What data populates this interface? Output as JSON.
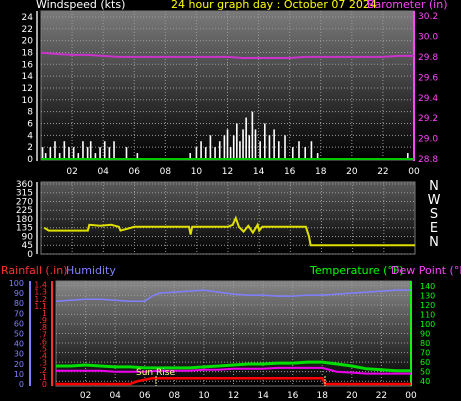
{
  "header": {
    "wind_label": "Windspeed (kts)",
    "date_title": "24 hour graph day : October 07 2024",
    "barometer_label": "Barometer (in)"
  },
  "labels": {
    "compass": [
      "N",
      "W",
      "S",
      "E",
      "N"
    ],
    "rainfall": "Rainfall (.in)",
    "humidity": "Humidity",
    "temperature": "Temperature (°F)",
    "dewpoint": "Dew Point (°F)",
    "sunrise": "Sun Rise"
  },
  "colors": {
    "wind": "#ffffff",
    "barometer": "#ff44ff",
    "direction": "#ffff00",
    "rain": "#ff0000",
    "humidity": "#8080ff",
    "temperature": "#00ff00",
    "dewpoint": "#ff00ff",
    "title": "#ffff00",
    "rain_label": "#ff3030",
    "humidity_label": "#8080ff",
    "temperature_label": "#00ff00",
    "dewpoint_label": "#ff40ff",
    "sunrise_label": "#ffff80"
  },
  "chart_data": [
    {
      "type": "bar",
      "id": "wind",
      "x_ticks": [
        "02",
        "04",
        "06",
        "08",
        "10",
        "12",
        "14",
        "16",
        "18",
        "20",
        "22",
        "00"
      ],
      "y_ticks": [
        0,
        2,
        4,
        6,
        8,
        10,
        12,
        14,
        16,
        18,
        20,
        22,
        24
      ],
      "ylim": [
        0,
        25
      ],
      "title": "Windspeed (kts)",
      "series": [
        {
          "name": "Windspeed (kts)",
          "x_hours": [
            0.1,
            0.3,
            0.6,
            0.9,
            1.2,
            1.5,
            1.8,
            2.1,
            2.4,
            2.7,
            3.0,
            3.2,
            3.5,
            3.8,
            4.1,
            4.4,
            4.7,
            5.5,
            6.2,
            9.6,
            10.0,
            10.3,
            10.6,
            10.9,
            11.2,
            11.5,
            11.8,
            12.0,
            12.2,
            12.4,
            12.6,
            12.8,
            13.0,
            13.2,
            13.4,
            13.6,
            13.8,
            14.1,
            14.4,
            14.7,
            15.0,
            15.3,
            15.7,
            16.2,
            16.6,
            17.0,
            17.4,
            17.8,
            23.6
          ],
          "values": [
            2,
            1,
            2,
            3,
            1,
            3,
            2,
            2,
            1,
            3,
            2,
            3,
            1,
            2,
            3,
            2,
            3,
            2,
            1,
            1,
            2,
            3,
            2,
            4,
            2,
            3,
            4,
            5,
            2,
            4,
            6,
            3,
            5,
            7,
            4,
            8,
            5,
            3,
            6,
            4,
            5,
            3,
            4,
            2,
            3,
            2,
            3,
            1,
            1
          ]
        },
        {
          "name": "Barometer (in)",
          "x_hours": [
            0,
            1,
            2,
            3,
            4,
            5,
            6,
            7,
            8,
            9,
            10,
            11,
            12,
            13,
            14,
            15,
            16,
            17,
            18,
            19,
            20,
            21,
            22,
            23,
            24
          ],
          "values": [
            29.84,
            29.83,
            29.82,
            29.82,
            29.81,
            29.8,
            29.8,
            29.8,
            29.8,
            29.8,
            29.8,
            29.8,
            29.8,
            29.79,
            29.79,
            29.79,
            29.79,
            29.8,
            29.8,
            29.8,
            29.8,
            29.8,
            29.8,
            29.81,
            29.81
          ],
          "ylim": [
            28.8,
            30.25
          ],
          "y_ticks": [
            28.8,
            29.0,
            29.2,
            29.4,
            29.6,
            29.8,
            30.0,
            30.2
          ]
        }
      ]
    },
    {
      "type": "line",
      "id": "direction",
      "y_ticks": [
        0,
        45,
        90,
        135,
        180,
        225,
        270,
        315,
        360
      ],
      "ylim": [
        0,
        370
      ],
      "series": [
        {
          "x_hours": [
            0.2,
            0.5,
            1.0,
            2.0,
            3.0,
            3.1,
            3.8,
            4.5,
            5.0,
            5.1,
            6.0,
            9.0,
            9.5,
            9.6,
            9.7,
            10.0,
            11.0,
            12.0,
            12.3,
            12.5,
            12.7,
            13.0,
            13.3,
            13.6,
            13.9,
            14.0,
            14.2,
            14.5,
            15.0,
            17.0,
            17.2,
            17.3,
            20.0,
            24.0
          ],
          "values": [
            135,
            120,
            120,
            120,
            120,
            150,
            145,
            150,
            140,
            120,
            140,
            140,
            140,
            100,
            140,
            140,
            140,
            140,
            150,
            185,
            140,
            115,
            145,
            110,
            150,
            120,
            140,
            140,
            140,
            140,
            90,
            45,
            45,
            45
          ]
        }
      ]
    },
    {
      "type": "line",
      "id": "temp",
      "x_ticks": [
        "02",
        "04",
        "06",
        "08",
        "10",
        "12",
        "14",
        "16",
        "18",
        "20",
        "22",
        "00"
      ],
      "y_ticks_left_humidity": [
        0,
        10,
        20,
        30,
        40,
        50,
        60,
        70,
        80,
        90,
        100
      ],
      "y_ticks_left_rain": [
        0.0,
        0.1,
        0.2,
        0.3,
        0.4,
        0.5,
        0.6,
        0.7,
        0.8,
        0.9,
        1.0,
        1.1,
        1.2,
        1.3,
        1.4
      ],
      "y_ticks_right_temp": [
        40,
        50,
        60,
        70,
        80,
        90,
        100,
        110,
        120,
        130,
        140
      ],
      "ylim_humidity": [
        0,
        100
      ],
      "ylim_temp": [
        35,
        145
      ],
      "ylim_rain": [
        0,
        1.45
      ],
      "series": [
        {
          "name": "Humidity",
          "x_hours": [
            0,
            1,
            2,
            3,
            4,
            5,
            6,
            6.5,
            7,
            8,
            9,
            10,
            11,
            12,
            13,
            14,
            15,
            16,
            17,
            18,
            19,
            20,
            21,
            22,
            23,
            24
          ],
          "values": [
            82,
            83,
            84,
            84,
            83,
            82,
            82,
            87,
            90,
            91,
            92,
            93,
            91,
            89,
            88,
            88,
            87,
            87,
            88,
            88,
            89,
            90,
            91,
            92,
            93,
            93
          ]
        },
        {
          "name": "Temperature (°F)",
          "x_hours": [
            0,
            1,
            2,
            3,
            4,
            5,
            6,
            7,
            8,
            9,
            10,
            11,
            12,
            13,
            14,
            15,
            16,
            17,
            18,
            19,
            20,
            21,
            22,
            23,
            24
          ],
          "values": [
            56,
            56,
            57,
            56,
            55,
            55,
            54,
            54,
            54,
            54,
            55,
            56,
            57,
            58,
            58,
            59,
            59,
            60,
            60,
            58,
            56,
            53,
            52,
            51,
            51
          ]
        },
        {
          "name": "Dew Point (°F)",
          "x_hours": [
            0,
            1,
            2,
            3,
            4,
            5,
            6,
            7,
            8,
            9,
            10,
            11,
            12,
            13,
            14,
            15,
            16,
            17,
            18,
            19,
            20,
            21,
            22,
            23,
            24
          ],
          "values": [
            51,
            51,
            51,
            51,
            50,
            50,
            50,
            51,
            51,
            51,
            52,
            52,
            53,
            53,
            53,
            54,
            54,
            54,
            54,
            50,
            49,
            48,
            48,
            48,
            48
          ]
        },
        {
          "name": "Rainfall (.in)",
          "x_hours": [
            0,
            2,
            4,
            5,
            5.5,
            6.5,
            8,
            12,
            16,
            18,
            18.2,
            20,
            24
          ],
          "values": [
            0.0,
            0.0,
            0.0,
            0.0,
            0.04,
            0.08,
            0.08,
            0.08,
            0.08,
            0.08,
            0.0,
            0.0,
            0.0
          ]
        }
      ]
    }
  ]
}
